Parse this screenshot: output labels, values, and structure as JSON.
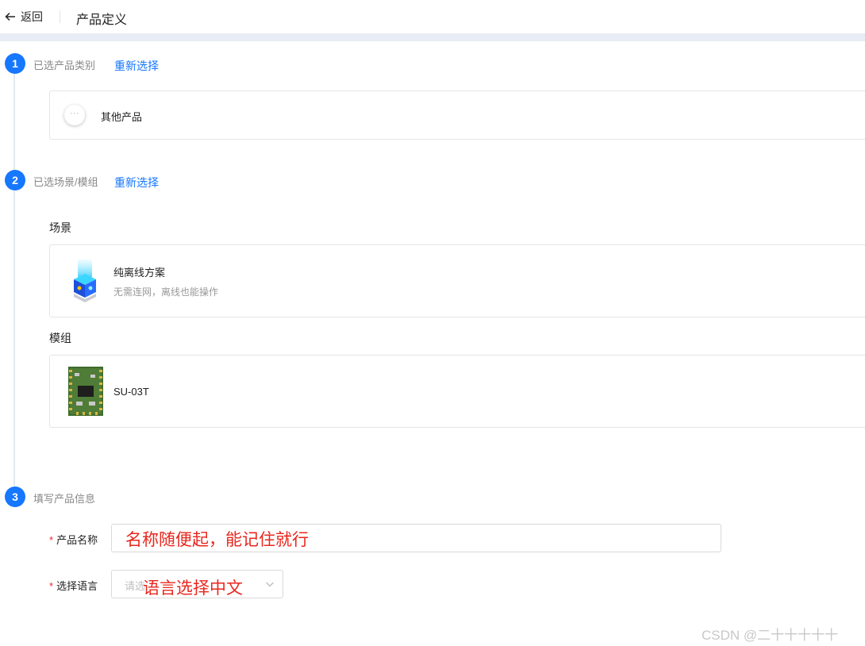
{
  "header": {
    "back_label": "返回",
    "title": "产品定义"
  },
  "steps": [
    {
      "number": "1",
      "label": "已选产品类别",
      "action": "重新选择"
    },
    {
      "number": "2",
      "label": "已选场景/模组",
      "action": "重新选择"
    },
    {
      "number": "3",
      "label": "填写产品信息"
    }
  ],
  "category": {
    "name": "其他产品",
    "icon": "ellipsis-circle-icon"
  },
  "scene": {
    "section_title": "场景",
    "name": "纯离线方案",
    "description": "无需连网，离线也能操作",
    "icon": "offline-cube-icon"
  },
  "module": {
    "section_title": "模组",
    "name": "SU-03T",
    "icon": "module-board-image"
  },
  "form": {
    "product_name_label": "产品名称",
    "language_label": "选择语言",
    "language_placeholder": "请选",
    "required_mark": "*"
  },
  "annotations": {
    "name_note": "名称随便起，能记住就行",
    "language_note": "语言选择中文"
  },
  "watermark": "CSDN @二十十十十十",
  "colors": {
    "accent": "#1677ff",
    "annotation": "#e8271e",
    "required": "#f5222d"
  }
}
